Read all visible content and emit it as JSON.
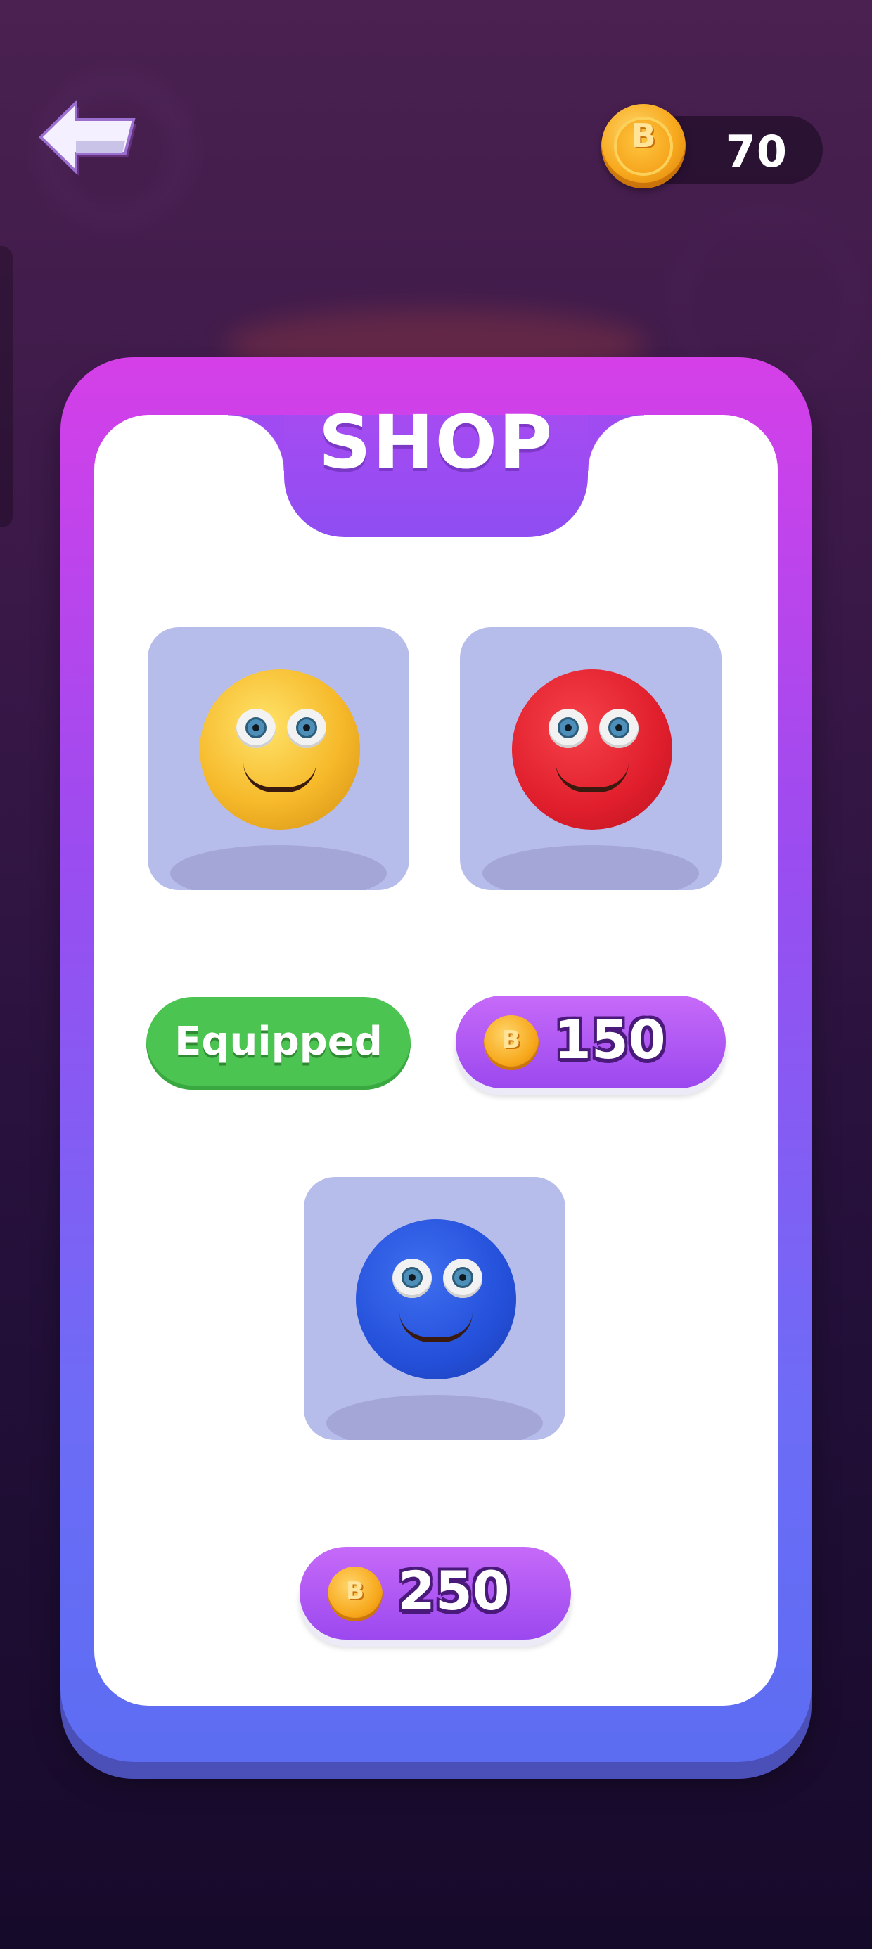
{
  "header": {
    "coin_symbol": "B",
    "coin_balance": "70"
  },
  "shop": {
    "title": "SHOP",
    "items": [
      {
        "skin": "yellow-ball",
        "status_label": "Equipped"
      },
      {
        "skin": "red-ball",
        "coin_symbol": "B",
        "price": "150"
      },
      {
        "skin": "blue-ball",
        "coin_symbol": "B",
        "price": "250"
      }
    ]
  },
  "colors": {
    "equipped_green": "#4cc451",
    "price_purple": "#9b48ef",
    "frame_top": "#d53fe8",
    "frame_bottom": "#5c6df2",
    "coin_gold": "#f7a81c"
  },
  "icons": {
    "back": "back-arrow-icon",
    "coin": "coin-icon"
  }
}
